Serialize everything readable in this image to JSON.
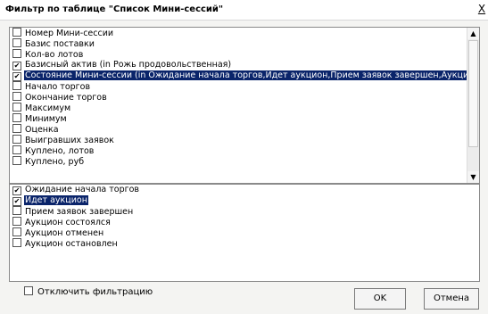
{
  "window": {
    "title": "Фильтр по таблице \"Список Мини-сессий\"",
    "close_label": "X"
  },
  "fields": [
    {
      "label": "Номер Мини-сессии",
      "checked": false,
      "selected": false
    },
    {
      "label": "Базис поставки",
      "checked": false,
      "selected": false
    },
    {
      "label": "Кол-во лотов",
      "checked": false,
      "selected": false
    },
    {
      "label": "Базисный актив (in Рожь продовольственная)",
      "checked": true,
      "selected": false
    },
    {
      "label": "Состояние Мини-сессии (in Ожидание начала торгов,Идет аукцион,Прием заявок завершен,Аукци",
      "checked": true,
      "selected": true
    },
    {
      "label": "Начало торгов",
      "checked": false,
      "selected": false
    },
    {
      "label": "Окончание торгов",
      "checked": false,
      "selected": false
    },
    {
      "label": "Максимум",
      "checked": false,
      "selected": false
    },
    {
      "label": "Минимум",
      "checked": false,
      "selected": false
    },
    {
      "label": "Оценка",
      "checked": false,
      "selected": false
    },
    {
      "label": "Выигравших заявок",
      "checked": false,
      "selected": false
    },
    {
      "label": "Куплено, лотов",
      "checked": false,
      "selected": false
    },
    {
      "label": "Куплено, руб",
      "checked": false,
      "selected": false
    }
  ],
  "states": [
    {
      "label": "Ожидание начала торгов",
      "checked": true,
      "selected": false
    },
    {
      "label": "Идет аукцион",
      "checked": true,
      "selected": true
    },
    {
      "label": "Прием заявок завершен",
      "checked": false,
      "selected": false
    },
    {
      "label": "Аукцион состоялся",
      "checked": false,
      "selected": false
    },
    {
      "label": "Аукцион отменен",
      "checked": false,
      "selected": false
    },
    {
      "label": "Аукцион остановлен",
      "checked": false,
      "selected": false
    }
  ],
  "disable_filter": {
    "label": "Отключить фильтрацию",
    "checked": false
  },
  "buttons": {
    "ok": "OK",
    "cancel": "Отмена"
  },
  "colors": {
    "selection": "#0a246a",
    "selection_text": "#ffffff"
  }
}
